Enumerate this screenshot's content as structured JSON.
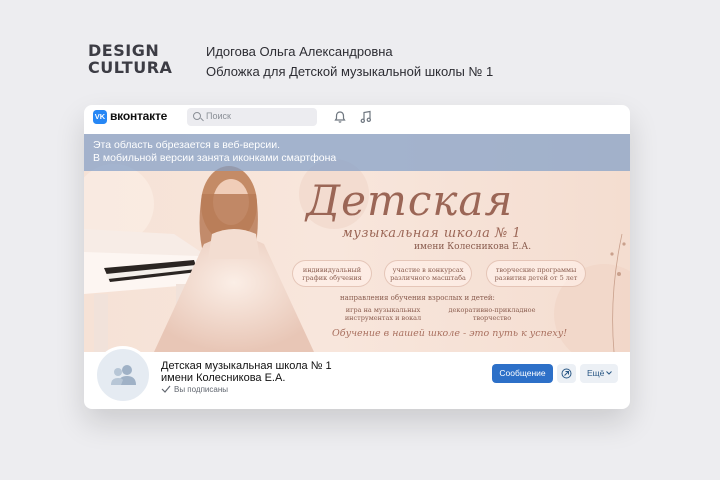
{
  "slide": {
    "brand_line1": "DESIGN",
    "brand_line2": "CULTURA",
    "author": "Идогова Ольга Александровна",
    "project": "Обложка для Детской музыкальной школы № 1"
  },
  "vk": {
    "logo_mark": "VK",
    "name": "вконтакте",
    "search_placeholder": "Поиск",
    "icons": [
      "search-icon",
      "bell-icon",
      "music-note-icon"
    ],
    "accent": "#2787f5"
  },
  "cover": {
    "mobile_note_line1": "Эта область обрезается в веб-версии.",
    "mobile_note_line2": "В мобильной версии занята иконками смартфона",
    "title": "Детская",
    "subtitle": "музыкальная школа № 1",
    "subtitle2": "имени Колесникова Е.А.",
    "features": [
      {
        "line1": "индивидуальный",
        "line2": "график обучения"
      },
      {
        "line1": "участие в конкурсах",
        "line2": "различного масштаба"
      },
      {
        "line1": "творческие программы",
        "line2": "развития детей от 5 лет"
      }
    ],
    "directions_title": "направления обучения взрослых и детей:",
    "direction_a_line1": "игра на музыкальных",
    "direction_a_line2": "инструментах и вокал",
    "direction_b_line1": "декоративно-прикладное",
    "direction_b_line2": "творчество",
    "slogan": "Обучение в нашей школе - это путь к успеху!"
  },
  "profile": {
    "name_line1": "Детская музыкальная школа № 1",
    "name_line2": "имени Колесникова Е.А.",
    "status": "Вы подписаны",
    "message_button": "Сообщение",
    "more_button": "Ещё",
    "button_color": "#2d70c8"
  }
}
